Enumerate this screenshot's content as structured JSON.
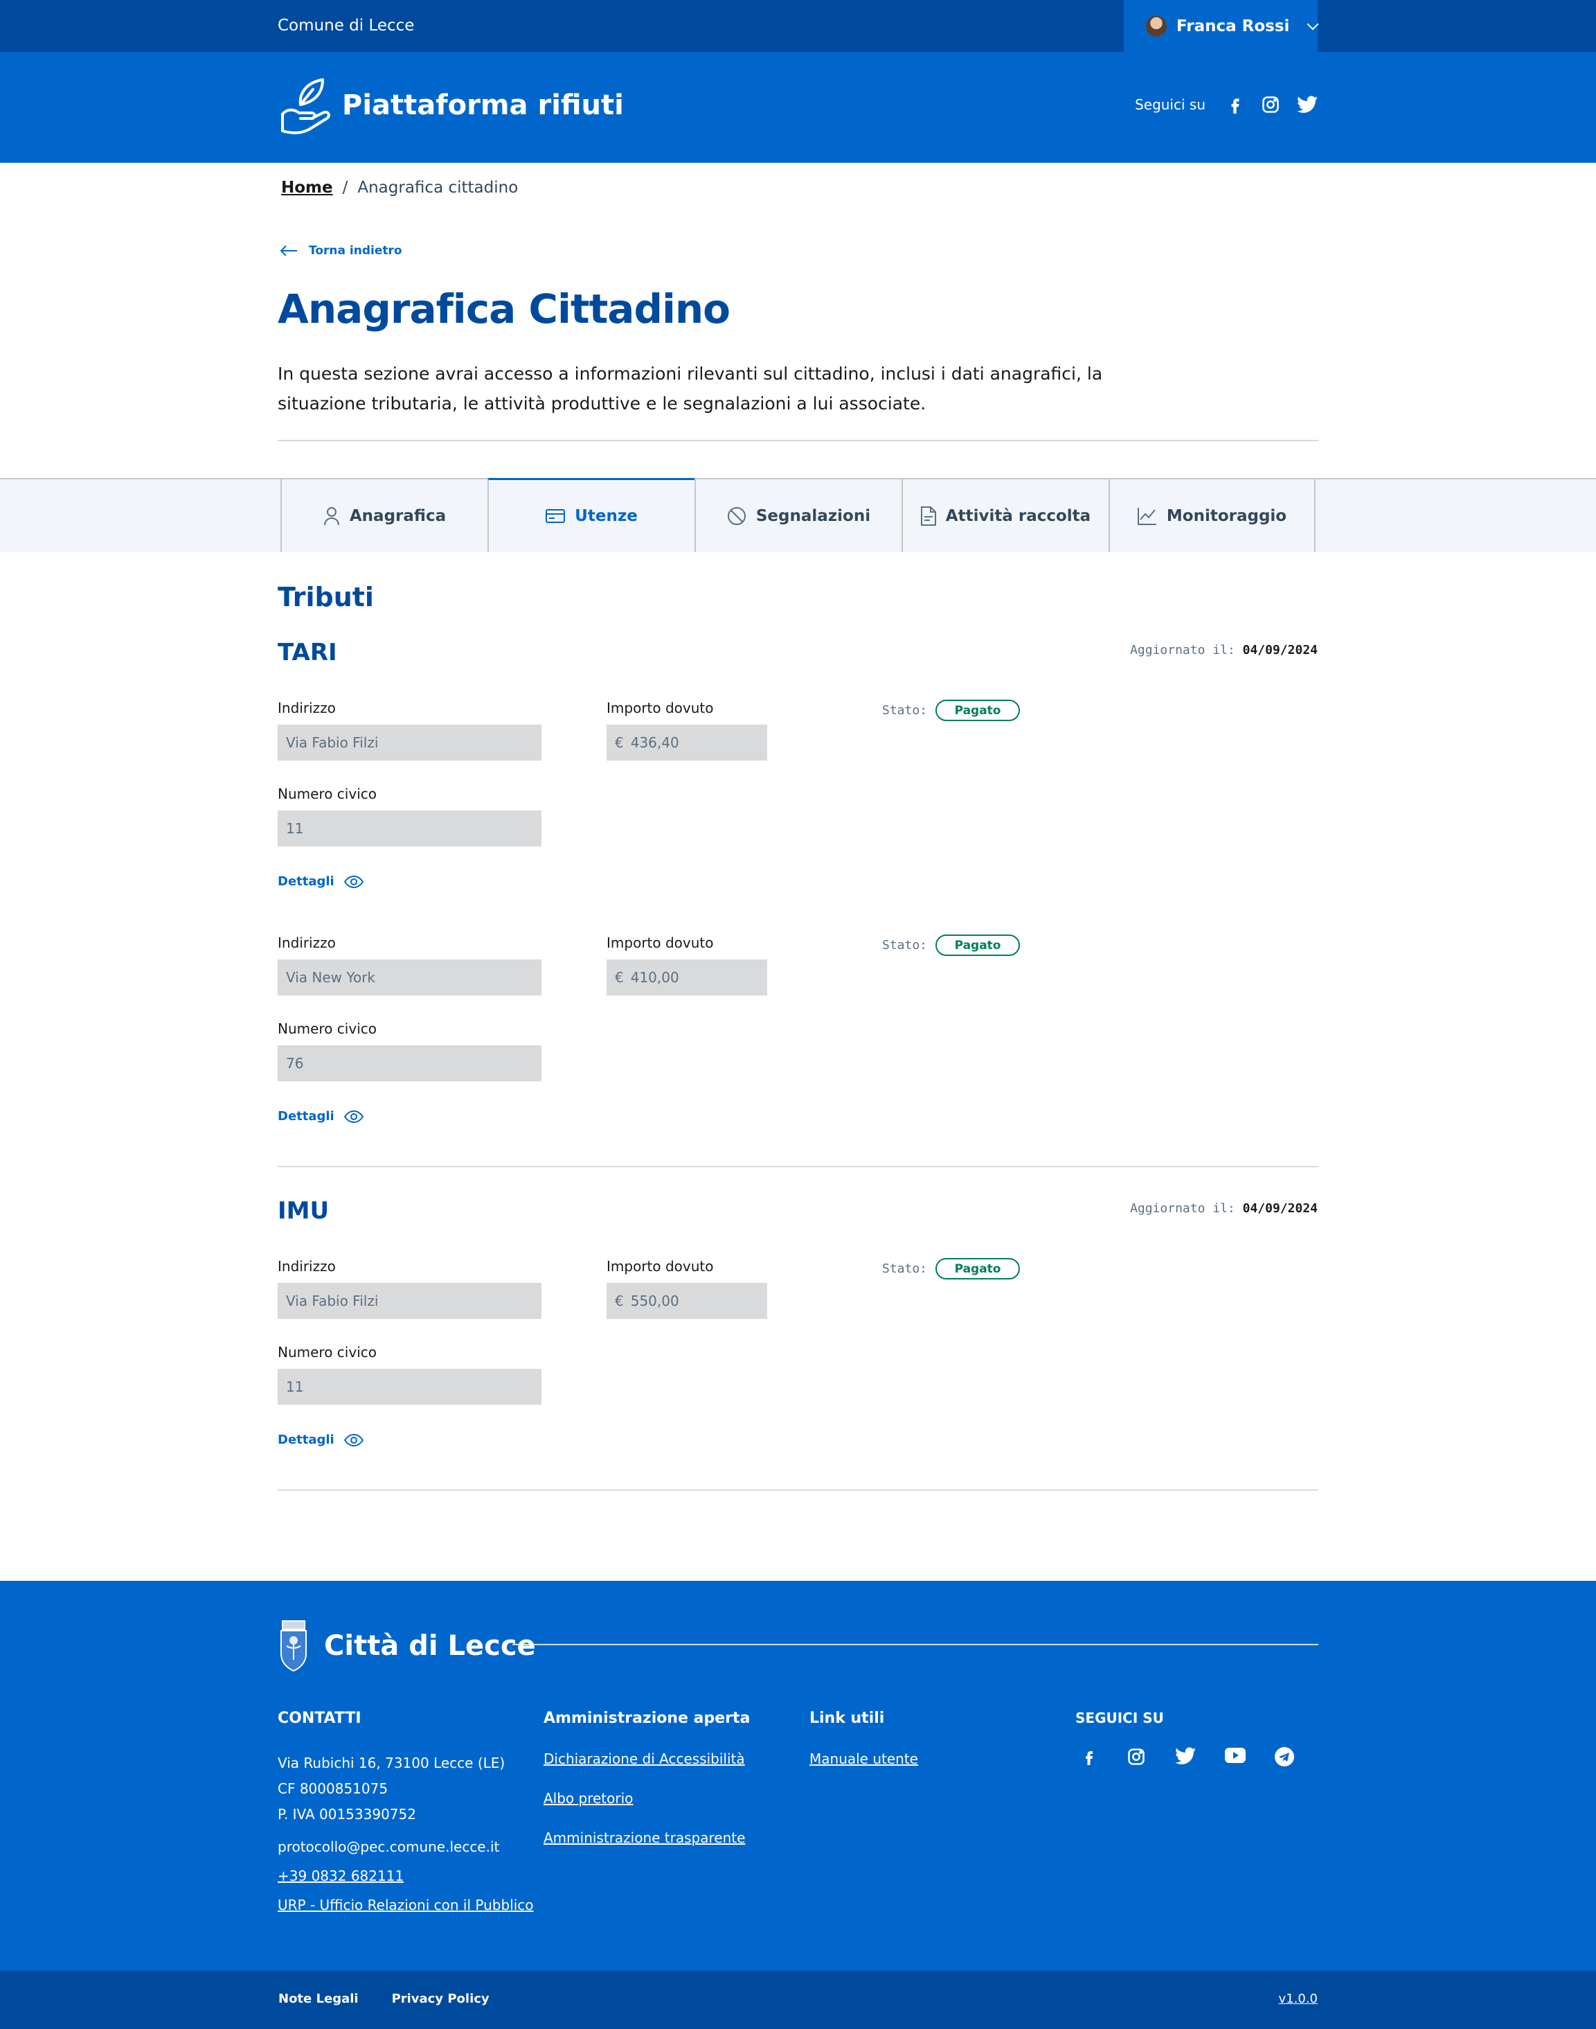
{
  "header": {
    "org_name": "Comune di Lecce",
    "user_name": "Franca Rossi",
    "app_title": "Piattaforma rifiuti",
    "follow_label": "Seguici su",
    "social_icons": [
      "facebook-icon",
      "instagram-icon",
      "twitter-icon"
    ]
  },
  "breadcrumb": {
    "home": "Home",
    "separator": "/",
    "current": "Anagrafica cittadino"
  },
  "back_label": "Torna indietro",
  "page": {
    "title": "Anagrafica Cittadino",
    "intro": "In questa sezione avrai accesso a informazioni rilevanti sul cittadino, inclusi i dati anagrafici, la situazione tributaria, le attività produttive e le segnalazioni a lui associate."
  },
  "tabs": [
    {
      "label": "Anagrafica",
      "icon": "user-icon"
    },
    {
      "label": "Utenze",
      "icon": "card-icon",
      "active": true
    },
    {
      "label": "Segnalazioni",
      "icon": "ban-icon"
    },
    {
      "label": "Attività raccolta",
      "icon": "file-icon"
    },
    {
      "label": "Monitoraggio",
      "icon": "chart-icon"
    }
  ],
  "section_title": "Tributi",
  "labels": {
    "address": "Indirizzo",
    "amount": "Importo dovuto",
    "civic": "Numero civico",
    "status": "Stato:",
    "details": "Dettagli",
    "updated": "Aggiornato il:",
    "currency": "€"
  },
  "tributes": [
    {
      "name": "TARI",
      "updated_date": "04/09/2024",
      "entries": [
        {
          "address": "Via  Fabio Filzi",
          "amount": "436,40",
          "civic": "11",
          "status": "Pagato"
        },
        {
          "address": "Via  New York",
          "amount": "410,00",
          "civic": "76",
          "status": "Pagato"
        }
      ]
    },
    {
      "name": "IMU",
      "updated_date": "04/09/2024",
      "entries": [
        {
          "address": "Via  Fabio Filzi",
          "amount": "550,00",
          "civic": "11",
          "status": "Pagato"
        }
      ]
    }
  ],
  "footer": {
    "city": "Città di Lecce",
    "contacts_title": "CONTATTI",
    "address_line": "Via Rubichi 16, 73100 Lecce (LE)",
    "cf": "CF 8000851075",
    "piva": "P. IVA 00153390752",
    "pec": "protocollo@pec.comune.lecce.it",
    "phone": "+39 0832 682111",
    "urp": "URP - Ufficio Relazioni con il Pubblico",
    "admin_title": "Amministrazione aperta",
    "admin_links": [
      "Dichiarazione di Accessibilità",
      "Albo pretorio",
      "Amministrazione trasparente"
    ],
    "useful_title": "Link utili",
    "useful_links": [
      "Manuale utente"
    ],
    "follow_title": "SEGUICI SU",
    "social_icons": [
      "facebook-icon",
      "instagram-icon",
      "twitter-icon",
      "youtube-icon",
      "telegram-icon"
    ],
    "legal": "Note Legali",
    "privacy": "Privacy Policy",
    "version": "v1.0.0"
  },
  "colors": {
    "primary": "#0066cc",
    "dark": "#004a9e",
    "success": "#008055",
    "field_bg": "#d9dadb"
  }
}
